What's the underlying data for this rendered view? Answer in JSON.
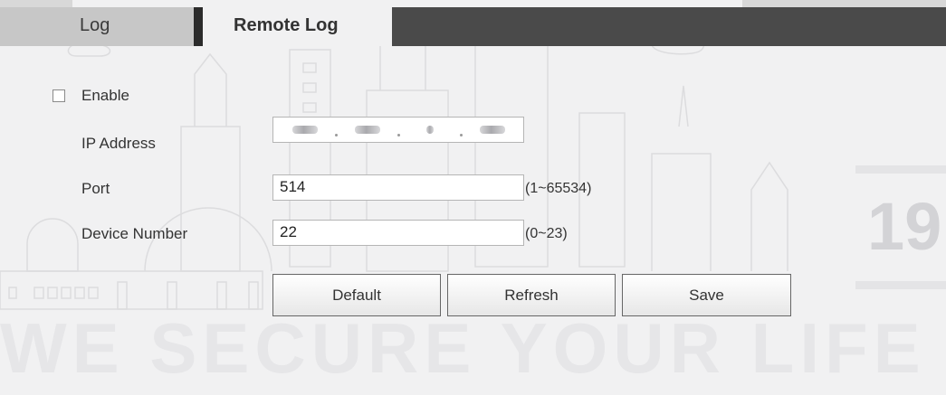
{
  "tabs": [
    {
      "label": "Log",
      "active": false
    },
    {
      "label": "Remote Log",
      "active": true
    }
  ],
  "form": {
    "enable": {
      "label": "Enable",
      "checked": false
    },
    "ip": {
      "label": "IP Address",
      "value": "(blurred)"
    },
    "port": {
      "label": "Port",
      "value": "514",
      "hint": "(1~65534)"
    },
    "device_number": {
      "label": "Device Number",
      "value": "22",
      "hint": "(0~23)"
    }
  },
  "buttons": {
    "default": "Default",
    "refresh": "Refresh",
    "save": "Save"
  },
  "watermark": {
    "slogan": "WE SECURE YOUR LIFE",
    "year": "19"
  },
  "colors": {
    "tab_inactive_bg": "#c7c7c7",
    "tab_bar_dark": "#4a4a4a",
    "page_bg": "#f1f1f2"
  }
}
